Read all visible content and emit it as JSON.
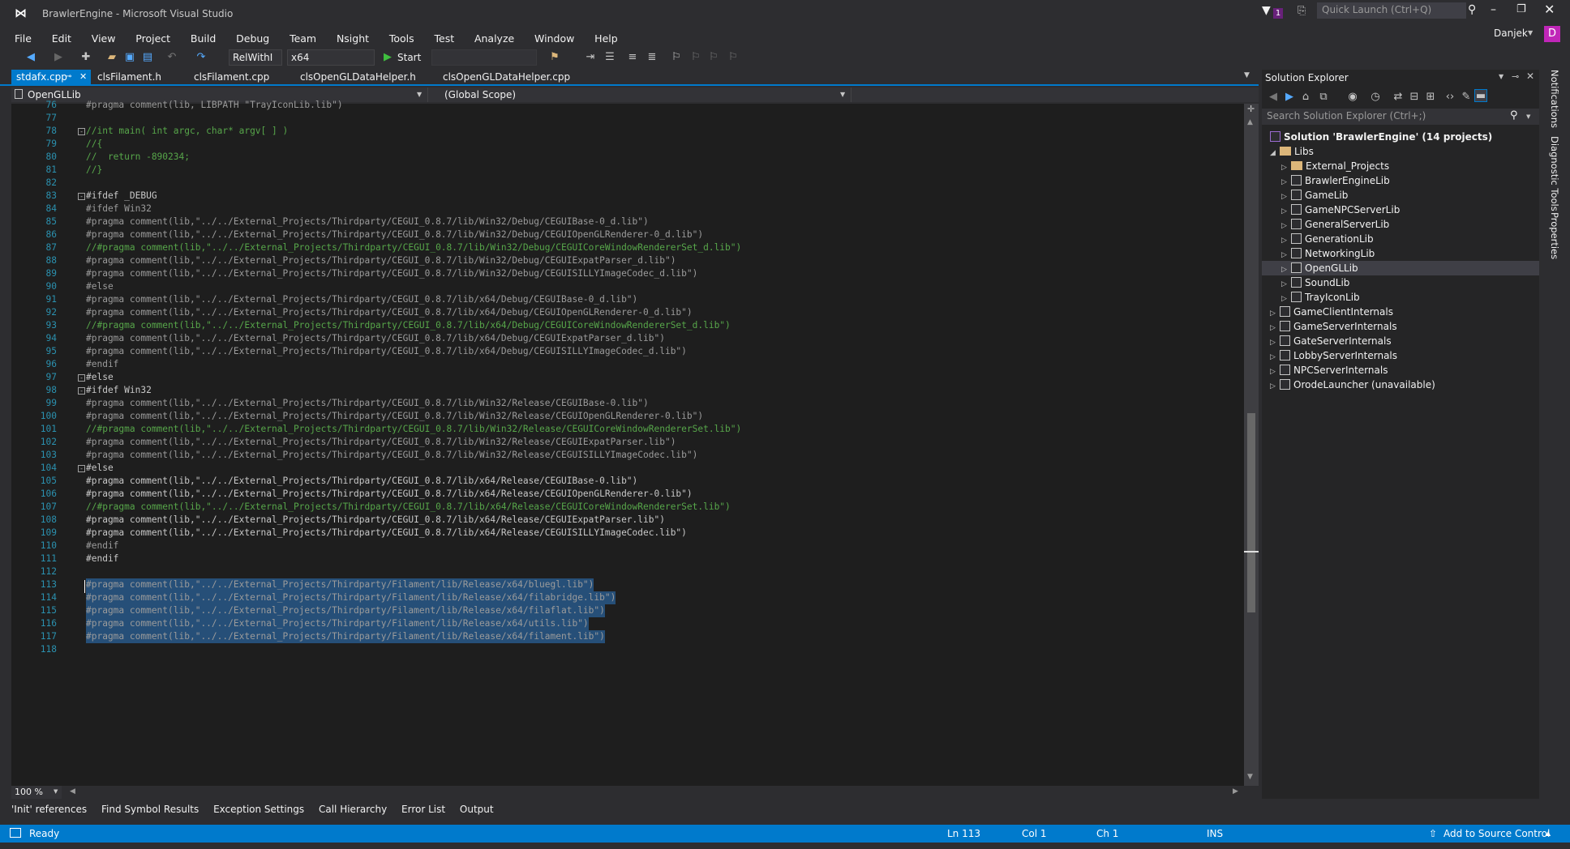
{
  "window": {
    "title": "BrawlerEngine - Microsoft Visual Studio",
    "quick_launch_placeholder": "Quick Launch (Ctrl+Q)",
    "notification_count": "1",
    "user": "Danjek",
    "user_initial": "D"
  },
  "menu": [
    "File",
    "Edit",
    "View",
    "Project",
    "Build",
    "Debug",
    "Team",
    "Nsight",
    "Tools",
    "Test",
    "Analyze",
    "Window",
    "Help"
  ],
  "toolbar": {
    "configuration": "RelWithI",
    "platform": "x64",
    "start_label": "Start"
  },
  "tabs": [
    {
      "label": "stdafx.cpp",
      "active": true
    },
    {
      "label": "clsFilament.h",
      "active": false
    },
    {
      "label": "clsFilament.cpp",
      "active": false
    },
    {
      "label": "clsOpenGLDataHelper.h",
      "active": false
    },
    {
      "label": "clsOpenGLDataHelper.cpp",
      "active": false
    }
  ],
  "nav": {
    "project": "OpenGLLib",
    "scope": "(Global Scope)"
  },
  "code_lines": [
    {
      "n": "76",
      "t": "#pragma comment(lib, LIBPATH \"TrayIconLib.lib\")",
      "c": "pp"
    },
    {
      "n": "77",
      "t": "",
      "c": "pp"
    },
    {
      "n": "78",
      "t": "//int main( int argc, char* argv[ ] )",
      "c": "comment",
      "fold": "-"
    },
    {
      "n": "79",
      "t": "//{",
      "c": "comment"
    },
    {
      "n": "80",
      "t": "//  return -890234;",
      "c": "comment"
    },
    {
      "n": "81",
      "t": "//}",
      "c": "comment"
    },
    {
      "n": "82",
      "t": "",
      "c": "pp"
    },
    {
      "n": "83",
      "t": "#ifdef _DEBUG",
      "c": "kw",
      "fold": "-"
    },
    {
      "n": "84",
      "t": "#ifdef Win32",
      "c": "pp"
    },
    {
      "n": "85",
      "t": "#pragma comment(lib,\"../../External_Projects/Thirdparty/CEGUI_0.8.7/lib/Win32/Debug/CEGUIBase-0_d.lib\")",
      "c": "pp"
    },
    {
      "n": "86",
      "t": "#pragma comment(lib,\"../../External_Projects/Thirdparty/CEGUI_0.8.7/lib/Win32/Debug/CEGUIOpenGLRenderer-0_d.lib\")",
      "c": "pp"
    },
    {
      "n": "87",
      "t": "//#pragma comment(lib,\"../../External_Projects/Thirdparty/CEGUI_0.8.7/lib/Win32/Debug/CEGUICoreWindowRendererSet_d.lib\")",
      "c": "comment"
    },
    {
      "n": "88",
      "t": "#pragma comment(lib,\"../../External_Projects/Thirdparty/CEGUI_0.8.7/lib/Win32/Debug/CEGUIExpatParser_d.lib\")",
      "c": "pp"
    },
    {
      "n": "89",
      "t": "#pragma comment(lib,\"../../External_Projects/Thirdparty/CEGUI_0.8.7/lib/Win32/Debug/CEGUISILLYImageCodec_d.lib\")",
      "c": "pp"
    },
    {
      "n": "90",
      "t": "#else",
      "c": "pp"
    },
    {
      "n": "91",
      "t": "#pragma comment(lib,\"../../External_Projects/Thirdparty/CEGUI_0.8.7/lib/x64/Debug/CEGUIBase-0_d.lib\")",
      "c": "pp"
    },
    {
      "n": "92",
      "t": "#pragma comment(lib,\"../../External_Projects/Thirdparty/CEGUI_0.8.7/lib/x64/Debug/CEGUIOpenGLRenderer-0_d.lib\")",
      "c": "pp"
    },
    {
      "n": "93",
      "t": "//#pragma comment(lib,\"../../External_Projects/Thirdparty/CEGUI_0.8.7/lib/x64/Debug/CEGUICoreWindowRendererSet_d.lib\")",
      "c": "comment"
    },
    {
      "n": "94",
      "t": "#pragma comment(lib,\"../../External_Projects/Thirdparty/CEGUI_0.8.7/lib/x64/Debug/CEGUIExpatParser_d.lib\")",
      "c": "pp"
    },
    {
      "n": "95",
      "t": "#pragma comment(lib,\"../../External_Projects/Thirdparty/CEGUI_0.8.7/lib/x64/Debug/CEGUISILLYImageCodec_d.lib\")",
      "c": "pp"
    },
    {
      "n": "96",
      "t": "#endif",
      "c": "pp"
    },
    {
      "n": "97",
      "t": "#else",
      "c": "kw",
      "fold": "-"
    },
    {
      "n": "98",
      "t": "#ifdef Win32",
      "c": "kw",
      "fold": "-"
    },
    {
      "n": "99",
      "t": "#pragma comment(lib,\"../../External_Projects/Thirdparty/CEGUI_0.8.7/lib/Win32/Release/CEGUIBase-0.lib\")",
      "c": "pp"
    },
    {
      "n": "100",
      "t": "#pragma comment(lib,\"../../External_Projects/Thirdparty/CEGUI_0.8.7/lib/Win32/Release/CEGUIOpenGLRenderer-0.lib\")",
      "c": "pp"
    },
    {
      "n": "101",
      "t": "//#pragma comment(lib,\"../../External_Projects/Thirdparty/CEGUI_0.8.7/lib/Win32/Release/CEGUICoreWindowRendererSet.lib\")",
      "c": "comment"
    },
    {
      "n": "102",
      "t": "#pragma comment(lib,\"../../External_Projects/Thirdparty/CEGUI_0.8.7/lib/Win32/Release/CEGUIExpatParser.lib\")",
      "c": "pp"
    },
    {
      "n": "103",
      "t": "#pragma comment(lib,\"../../External_Projects/Thirdparty/CEGUI_0.8.7/lib/Win32/Release/CEGUISILLYImageCodec.lib\")",
      "c": "pp"
    },
    {
      "n": "104",
      "t": "#else",
      "c": "kw",
      "fold": "-"
    },
    {
      "n": "105",
      "t": "#pragma comment(lib,\"../../External_Projects/Thirdparty/CEGUI_0.8.7/lib/x64/Release/CEGUIBase-0.lib\")",
      "c": "kw"
    },
    {
      "n": "106",
      "t": "#pragma comment(lib,\"../../External_Projects/Thirdparty/CEGUI_0.8.7/lib/x64/Release/CEGUIOpenGLRenderer-0.lib\")",
      "c": "kw"
    },
    {
      "n": "107",
      "t": "//#pragma comment(lib,\"../../External_Projects/Thirdparty/CEGUI_0.8.7/lib/x64/Release/CEGUICoreWindowRendererSet.lib\")",
      "c": "comment"
    },
    {
      "n": "108",
      "t": "#pragma comment(lib,\"../../External_Projects/Thirdparty/CEGUI_0.8.7/lib/x64/Release/CEGUIExpatParser.lib\")",
      "c": "kw"
    },
    {
      "n": "109",
      "t": "#pragma comment(lib,\"../../External_Projects/Thirdparty/CEGUI_0.8.7/lib/x64/Release/CEGUISILLYImageCodec.lib\")",
      "c": "kw"
    },
    {
      "n": "110",
      "t": "#endif",
      "c": "pp"
    },
    {
      "n": "111",
      "t": "#endif",
      "c": "kw"
    },
    {
      "n": "112",
      "t": "",
      "c": "pp"
    },
    {
      "n": "113",
      "t": "#pragma comment(lib,\"../../External_Projects/Thirdparty/Filament/lib/Release/x64/bluegl.lib\")",
      "c": "sel"
    },
    {
      "n": "114",
      "t": "#pragma comment(lib,\"../../External_Projects/Thirdparty/Filament/lib/Release/x64/filabridge.lib\")",
      "c": "sel"
    },
    {
      "n": "115",
      "t": "#pragma comment(lib,\"../../External_Projects/Thirdparty/Filament/lib/Release/x64/filaflat.lib\")",
      "c": "sel"
    },
    {
      "n": "116",
      "t": "#pragma comment(lib,\"../../External_Projects/Thirdparty/Filament/lib/Release/x64/utils.lib\")",
      "c": "sel"
    },
    {
      "n": "117",
      "t": "#pragma comment(lib,\"../../External_Projects/Thirdparty/Filament/lib/Release/x64/filament.lib\")",
      "c": "sel"
    },
    {
      "n": "118",
      "t": "",
      "c": "pp"
    }
  ],
  "zoom": "100 %",
  "bottom_tabs": [
    "'Init' references",
    "Find Symbol Results",
    "Exception Settings",
    "Call Hierarchy",
    "Error List",
    "Output"
  ],
  "status": {
    "ready": "Ready",
    "ln": "Ln 113",
    "col": "Col 1",
    "ch": "Ch 1",
    "mode": "INS",
    "source_control": "Add to Source Control"
  },
  "solution_explorer": {
    "title": "Solution Explorer",
    "search_placeholder": "Search Solution Explorer (Ctrl+;)",
    "solution": "Solution 'BrawlerEngine' (14 projects)",
    "folder": "Libs",
    "lib_items": [
      "External_Projects",
      "BrawlerEngineLib",
      "GameLib",
      "GameNPCServerLib",
      "GeneralServerLib",
      "GenerationLib",
      "NetworkingLib",
      "OpenGLLib",
      "SoundLib",
      "TrayIconLib"
    ],
    "top_items": [
      "GameClientInternals",
      "GameServerInternals",
      "GateServerInternals",
      "LobbyServerInternals",
      "NPCServerInternals",
      "OrodeLauncher (unavailable)"
    ],
    "selected": "OpenGLLib"
  },
  "right_rail": [
    "Notifications",
    "Diagnostic Tools",
    "Properties"
  ]
}
